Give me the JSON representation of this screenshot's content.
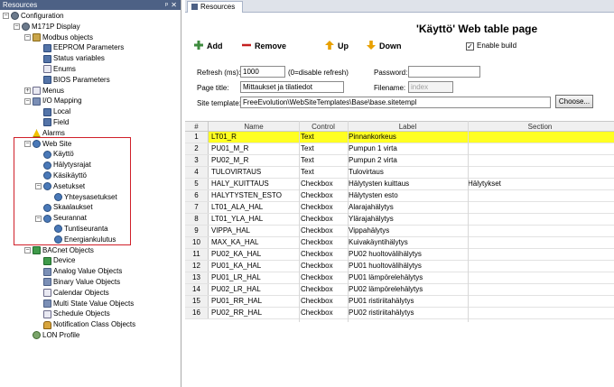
{
  "left_pane": {
    "title": "Resources",
    "pin_glyph": "ᵖ",
    "close_glyph": "✕",
    "tree": [
      {
        "label": "Configuration",
        "icon": "gear-icon",
        "expander": "−"
      },
      {
        "label": "M171P Display",
        "icon": "gear-icon",
        "expander": "−"
      },
      {
        "label": "Modbus objects",
        "icon": "folder-icon",
        "expander": "−"
      },
      {
        "label": "EEPROM Parameters",
        "icon": "grid-icon",
        "expander": ""
      },
      {
        "label": "Status variables",
        "icon": "grid-icon",
        "expander": ""
      },
      {
        "label": "Enums",
        "icon": "page-icon",
        "expander": ""
      },
      {
        "label": "BIOS Parameters",
        "icon": "grid-icon",
        "expander": ""
      },
      {
        "label": "Menus",
        "icon": "page-icon",
        "expander": "+"
      },
      {
        "label": "I/O Mapping",
        "icon": "small-grid-icon",
        "expander": "−"
      },
      {
        "label": "Local",
        "icon": "grid-icon",
        "expander": ""
      },
      {
        "label": "Field",
        "icon": "grid-icon",
        "expander": ""
      },
      {
        "label": "Alarms",
        "icon": "warning-icon",
        "expander": ""
      },
      {
        "label": "Web Site",
        "icon": "globe-icon",
        "expander": "−"
      },
      {
        "label": "Käyttö",
        "icon": "globe-icon",
        "expander": ""
      },
      {
        "label": "Hälytysrajat",
        "icon": "globe-icon",
        "expander": ""
      },
      {
        "label": "Käsikäyttö",
        "icon": "globe-icon",
        "expander": ""
      },
      {
        "label": "Asetukset",
        "icon": "globe-icon",
        "expander": "−"
      },
      {
        "label": "Yhteysasetukset",
        "icon": "globe-icon",
        "expander": ""
      },
      {
        "label": "Skaalaukset",
        "icon": "globe-icon",
        "expander": ""
      },
      {
        "label": "Seurannat",
        "icon": "globe-icon",
        "expander": "−"
      },
      {
        "label": "Tuntiseuranta",
        "icon": "globe-icon",
        "expander": ""
      },
      {
        "label": "Energiankulutus",
        "icon": "globe-icon",
        "expander": ""
      },
      {
        "label": "BACnet Objects",
        "icon": "network-icon",
        "expander": "−"
      },
      {
        "label": "Device",
        "icon": "network-icon",
        "expander": ""
      },
      {
        "label": "Analog Value Objects",
        "icon": "small-grid-icon",
        "expander": ""
      },
      {
        "label": "Binary Value Objects",
        "icon": "small-grid-icon",
        "expander": ""
      },
      {
        "label": "Calendar Objects",
        "icon": "page-icon",
        "expander": ""
      },
      {
        "label": "Multi State Value Objects",
        "icon": "small-grid-icon",
        "expander": ""
      },
      {
        "label": "Schedule Objects",
        "icon": "page-icon",
        "expander": ""
      },
      {
        "label": "Notification Class Objects",
        "icon": "bell-icon",
        "expander": ""
      },
      {
        "label": "LON Profile",
        "icon": "person-icon",
        "expander": ""
      }
    ]
  },
  "tab": {
    "label": "Resources"
  },
  "page": {
    "title": "'Käyttö' Web table page"
  },
  "toolbar": {
    "add_label": "Add",
    "remove_label": "Remove",
    "up_label": "Up",
    "down_label": "Down",
    "enable_build_label": "Enable build",
    "enable_build_checked": "✓"
  },
  "form": {
    "refresh_label": "Refresh (ms):",
    "refresh_value": "1000",
    "refresh_hint": "(0=disable refresh)",
    "password_label": "Password:",
    "password_value": "",
    "page_title_label": "Page title:",
    "page_title_value": "Mittaukset ja tilatiedot",
    "filename_label": "Filename:",
    "filename_value": "index",
    "site_template_label": "Site template:",
    "site_template_value": "FreeEvolution\\WebSiteTemplates\\Base\\base.sitetempl",
    "choose_label": "Choose..."
  },
  "table": {
    "columns": [
      "#",
      "Name",
      "Control",
      "Label",
      "Section"
    ],
    "rows": [
      {
        "idx": "1",
        "name": "LT01_R",
        "control": "Text",
        "label": "Pinnankorkeus",
        "section": ""
      },
      {
        "idx": "2",
        "name": "PU01_M_R",
        "control": "Text",
        "label": "Pumpun 1 virta",
        "section": ""
      },
      {
        "idx": "3",
        "name": "PU02_M_R",
        "control": "Text",
        "label": "Pumpun 2 virta",
        "section": ""
      },
      {
        "idx": "4",
        "name": "TULOVIRTAUS",
        "control": "Text",
        "label": "Tulovirtaus",
        "section": ""
      },
      {
        "idx": "5",
        "name": "HALY_KUITTAUS",
        "control": "Checkbox",
        "label": "Hälytysten kuittaus",
        "section": "Hälytykset"
      },
      {
        "idx": "6",
        "name": "HALYTYSTEN_ESTO",
        "control": "Checkbox",
        "label": "Hälytysten esto",
        "section": ""
      },
      {
        "idx": "7",
        "name": "LT01_ALA_HAL",
        "control": "Checkbox",
        "label": "Alarajahälytys",
        "section": ""
      },
      {
        "idx": "8",
        "name": "LT01_YLA_HAL",
        "control": "Checkbox",
        "label": "Ylärajahälytys",
        "section": ""
      },
      {
        "idx": "9",
        "name": "VIPPA_HAL",
        "control": "Checkbox",
        "label": "Vippahälytys",
        "section": ""
      },
      {
        "idx": "10",
        "name": "MAX_KA_HAL",
        "control": "Checkbox",
        "label": "Kuivakäyntihälytys",
        "section": ""
      },
      {
        "idx": "11",
        "name": "PU02_KA_HAL",
        "control": "Checkbox",
        "label": "PU02 huoltovälihälytys",
        "section": ""
      },
      {
        "idx": "12",
        "name": "PU01_KA_HAL",
        "control": "Checkbox",
        "label": "PU01 huoltovälihälytys",
        "section": ""
      },
      {
        "idx": "13",
        "name": "PU01_LR_HAL",
        "control": "Checkbox",
        "label": "PU01 lämpörelehälytys",
        "section": ""
      },
      {
        "idx": "14",
        "name": "PU02_LR_HAL",
        "control": "Checkbox",
        "label": "PU02 lämpörelehälytys",
        "section": ""
      },
      {
        "idx": "15",
        "name": "PU01_RR_HAL",
        "control": "Checkbox",
        "label": "PU01 ristiriitahälytys",
        "section": ""
      },
      {
        "idx": "16",
        "name": "PU02_RR_HAL",
        "control": "Checkbox",
        "label": "PU02 ristiriitahälytys",
        "section": ""
      }
    ],
    "selected_row": 0,
    "selected_color": "#ffff22"
  }
}
